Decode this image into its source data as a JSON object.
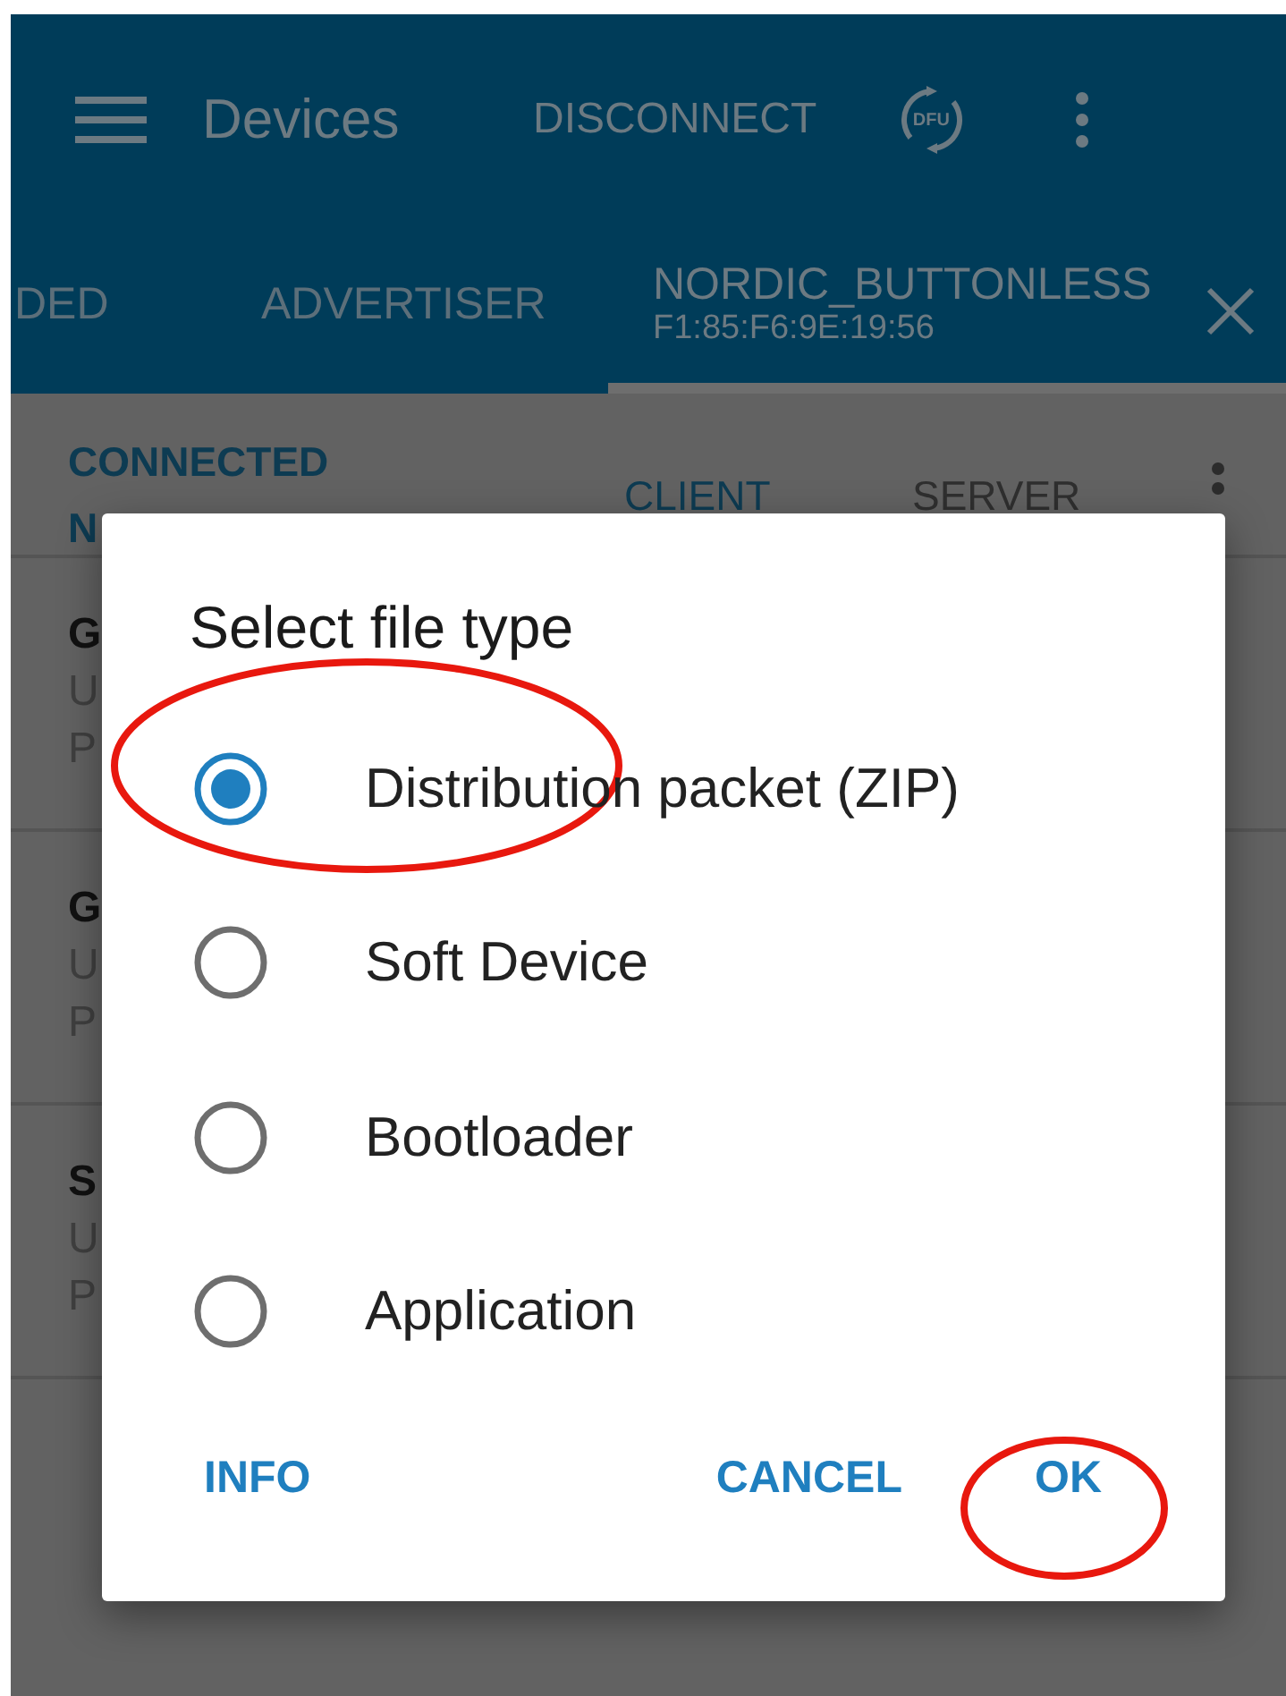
{
  "app_bar": {
    "title": "Devices",
    "action": "DISCONNECT",
    "dfu": "DFU"
  },
  "tabs": [
    {
      "label": "DED",
      "selected": false
    },
    {
      "label": "ADVERTISER",
      "selected": false
    },
    {
      "label": "NORDIC_BUTTONLESS",
      "subtitle": "F1:85:F6:9E:19:56",
      "selected": true
    }
  ],
  "sub_bar": {
    "status": [
      "CONNECTED",
      "N"
    ],
    "tabs": [
      {
        "label": "CLIENT",
        "selected": true
      },
      {
        "label": "SERVER",
        "selected": false
      }
    ]
  },
  "rows": [
    {
      "lines": [
        "G",
        "U",
        "P"
      ]
    },
    {
      "lines": [
        "G",
        "U",
        "P"
      ]
    },
    {
      "lines": [
        "S",
        "U",
        "P"
      ]
    }
  ],
  "dialog": {
    "title": "Select file type",
    "options": [
      {
        "label": "Distribution packet (ZIP)",
        "selected": true
      },
      {
        "label": "Soft Device",
        "selected": false
      },
      {
        "label": "Bootloader",
        "selected": false
      },
      {
        "label": "Application",
        "selected": false
      }
    ],
    "buttons": [
      {
        "label": "INFO",
        "kind": "left"
      },
      {
        "label": "CANCEL",
        "kind": "right"
      },
      {
        "label": "OK",
        "kind": "right"
      }
    ]
  }
}
